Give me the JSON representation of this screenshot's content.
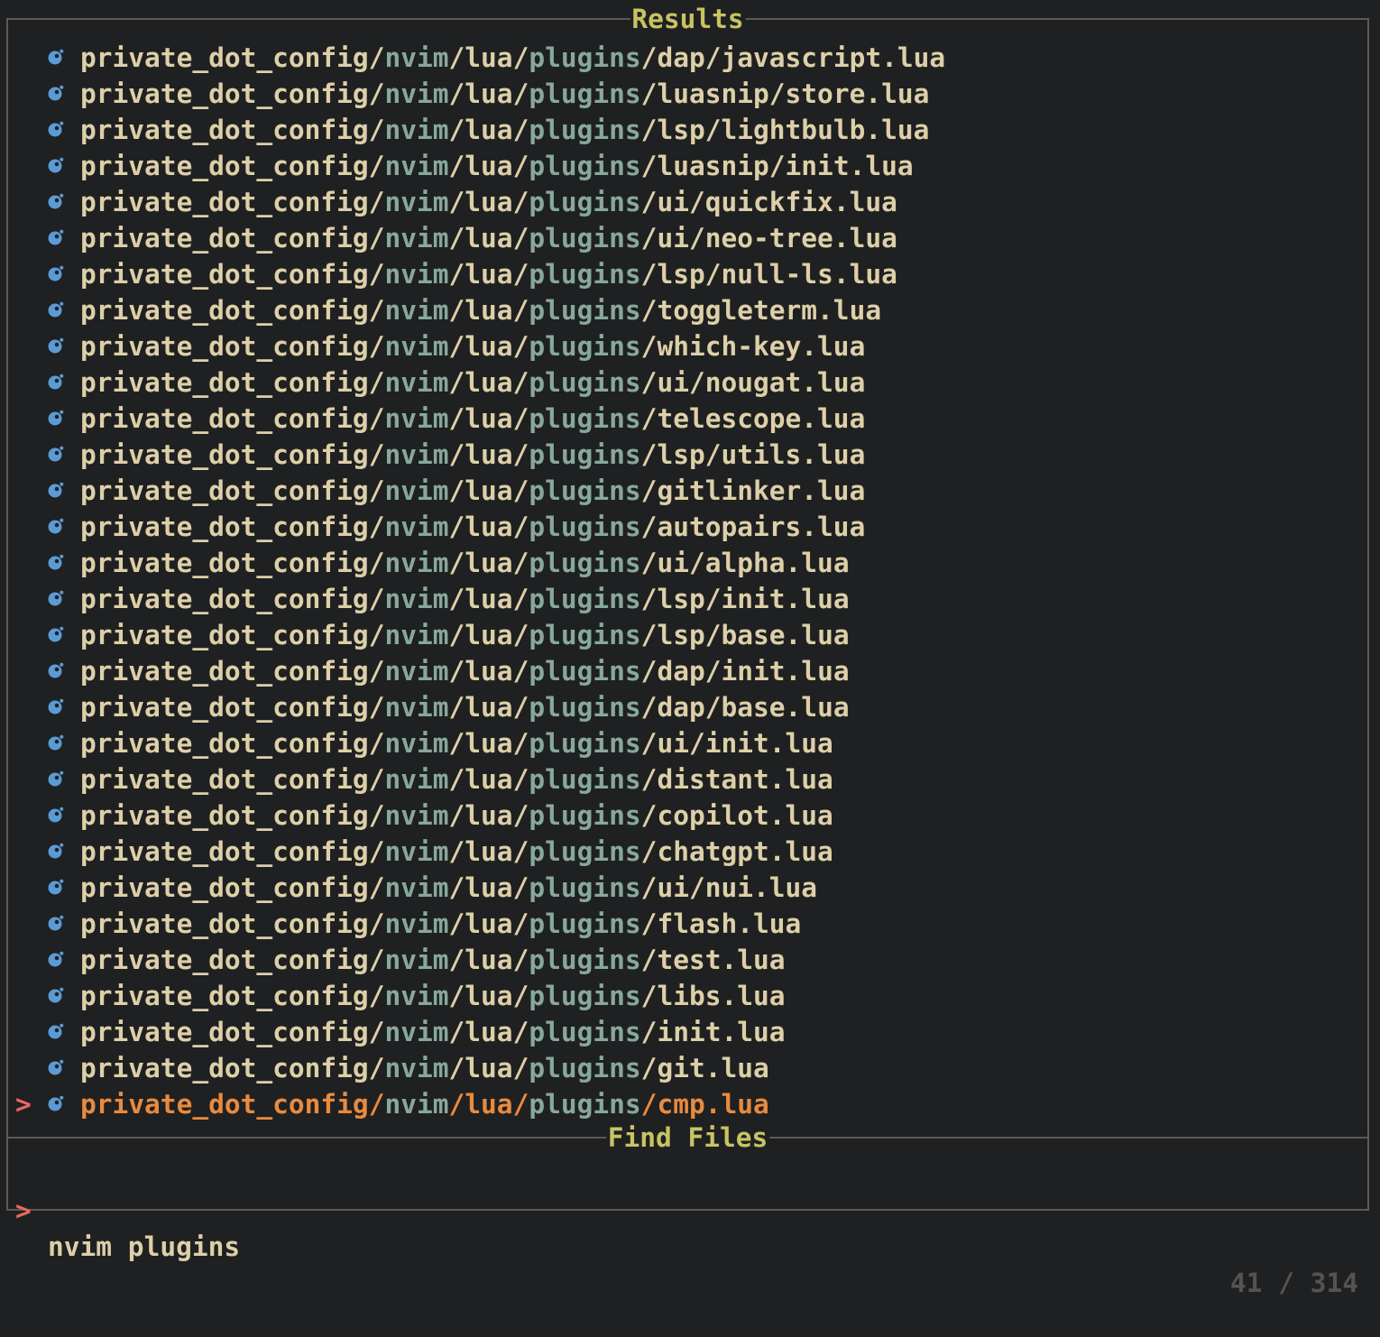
{
  "results_title": "Results",
  "prompt_title": "Find Files",
  "caret": ">",
  "icon_name": "lua-file-icon",
  "colors": {
    "background": "#1f2021",
    "text": "#ddcfa8",
    "match_highlight": "#87a89a",
    "selected_text": "#e98a3e",
    "caret": "#ea6962",
    "title": "#c8c363",
    "border": "#5c5a54",
    "icon": "#5b9bd5",
    "counter": "#55534d"
  },
  "query_terms": [
    "nvim",
    "plugins"
  ],
  "prompt": {
    "symbol": ">",
    "query": "nvim plugins",
    "counter": "41 / 314"
  },
  "results": [
    {
      "path": "private_dot_config/nvim/lua/plugins/dap/javascript.lua",
      "selected": false
    },
    {
      "path": "private_dot_config/nvim/lua/plugins/luasnip/store.lua",
      "selected": false
    },
    {
      "path": "private_dot_config/nvim/lua/plugins/lsp/lightbulb.lua",
      "selected": false
    },
    {
      "path": "private_dot_config/nvim/lua/plugins/luasnip/init.lua",
      "selected": false
    },
    {
      "path": "private_dot_config/nvim/lua/plugins/ui/quickfix.lua",
      "selected": false
    },
    {
      "path": "private_dot_config/nvim/lua/plugins/ui/neo-tree.lua",
      "selected": false
    },
    {
      "path": "private_dot_config/nvim/lua/plugins/lsp/null-ls.lua",
      "selected": false
    },
    {
      "path": "private_dot_config/nvim/lua/plugins/toggleterm.lua",
      "selected": false
    },
    {
      "path": "private_dot_config/nvim/lua/plugins/which-key.lua",
      "selected": false
    },
    {
      "path": "private_dot_config/nvim/lua/plugins/ui/nougat.lua",
      "selected": false
    },
    {
      "path": "private_dot_config/nvim/lua/plugins/telescope.lua",
      "selected": false
    },
    {
      "path": "private_dot_config/nvim/lua/plugins/lsp/utils.lua",
      "selected": false
    },
    {
      "path": "private_dot_config/nvim/lua/plugins/gitlinker.lua",
      "selected": false
    },
    {
      "path": "private_dot_config/nvim/lua/plugins/autopairs.lua",
      "selected": false
    },
    {
      "path": "private_dot_config/nvim/lua/plugins/ui/alpha.lua",
      "selected": false
    },
    {
      "path": "private_dot_config/nvim/lua/plugins/lsp/init.lua",
      "selected": false
    },
    {
      "path": "private_dot_config/nvim/lua/plugins/lsp/base.lua",
      "selected": false
    },
    {
      "path": "private_dot_config/nvim/lua/plugins/dap/init.lua",
      "selected": false
    },
    {
      "path": "private_dot_config/nvim/lua/plugins/dap/base.lua",
      "selected": false
    },
    {
      "path": "private_dot_config/nvim/lua/plugins/ui/init.lua",
      "selected": false
    },
    {
      "path": "private_dot_config/nvim/lua/plugins/distant.lua",
      "selected": false
    },
    {
      "path": "private_dot_config/nvim/lua/plugins/copilot.lua",
      "selected": false
    },
    {
      "path": "private_dot_config/nvim/lua/plugins/chatgpt.lua",
      "selected": false
    },
    {
      "path": "private_dot_config/nvim/lua/plugins/ui/nui.lua",
      "selected": false
    },
    {
      "path": "private_dot_config/nvim/lua/plugins/flash.lua",
      "selected": false
    },
    {
      "path": "private_dot_config/nvim/lua/plugins/test.lua",
      "selected": false
    },
    {
      "path": "private_dot_config/nvim/lua/plugins/libs.lua",
      "selected": false
    },
    {
      "path": "private_dot_config/nvim/lua/plugins/init.lua",
      "selected": false
    },
    {
      "path": "private_dot_config/nvim/lua/plugins/git.lua",
      "selected": false
    },
    {
      "path": "private_dot_config/nvim/lua/plugins/cmp.lua",
      "selected": true
    }
  ]
}
